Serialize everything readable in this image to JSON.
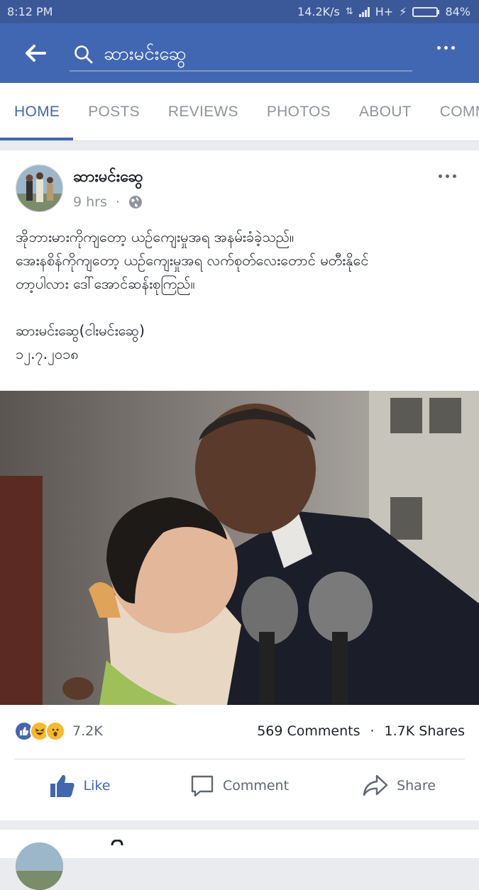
{
  "status_bar": {
    "time": "8:12 PM",
    "network_speed": "14.2K/s",
    "network_type": "H+",
    "battery": "84%",
    "battery_level": 0.84
  },
  "header": {
    "search_query": "ဆားမင်းဆွေ"
  },
  "tabs": [
    {
      "label": "HOME",
      "active": true
    },
    {
      "label": "POSTS",
      "active": false
    },
    {
      "label": "REVIEWS",
      "active": false
    },
    {
      "label": "PHOTOS",
      "active": false
    },
    {
      "label": "ABOUT",
      "active": false
    },
    {
      "label": "COMMUN",
      "active": false
    }
  ],
  "post": {
    "author": "ဆားမင်းဆွေ",
    "time": "9 hrs",
    "privacy_icon": "globe-icon",
    "text_lines": [
      "အိုဘားမားကိုကျတော့ ယဉ်ကျေးမှုအရ အနမ်းခံခဲ့သည်။",
      "အေးနစိန်ကိုကျတော့ ယဉ်ကျေးမှုအရ လက်စုတ်လေးတောင် မတီးနိုင်ေ",
      "တာ့ပါလား ဒေါ်အောင်ဆန်းစုကြည်။"
    ],
    "signature": "ဆားမင်းဆွေ(ငါးမင်းဆွေ)",
    "date": "၁၂.၇.၂၀၁၈",
    "reactions": {
      "icons": [
        "like-icon",
        "haha-icon",
        "wow-icon"
      ],
      "count": "7.2K"
    },
    "comments": "569 Comments",
    "separator": "·",
    "shares": "1.7K Shares",
    "actions": {
      "like": "Like",
      "comment": "Comment",
      "share": "Share"
    }
  },
  "colors": {
    "status_bar": "#3b5998",
    "app_bar": "#4267b2",
    "accent": "#4267b2",
    "muted": "#90949c"
  }
}
